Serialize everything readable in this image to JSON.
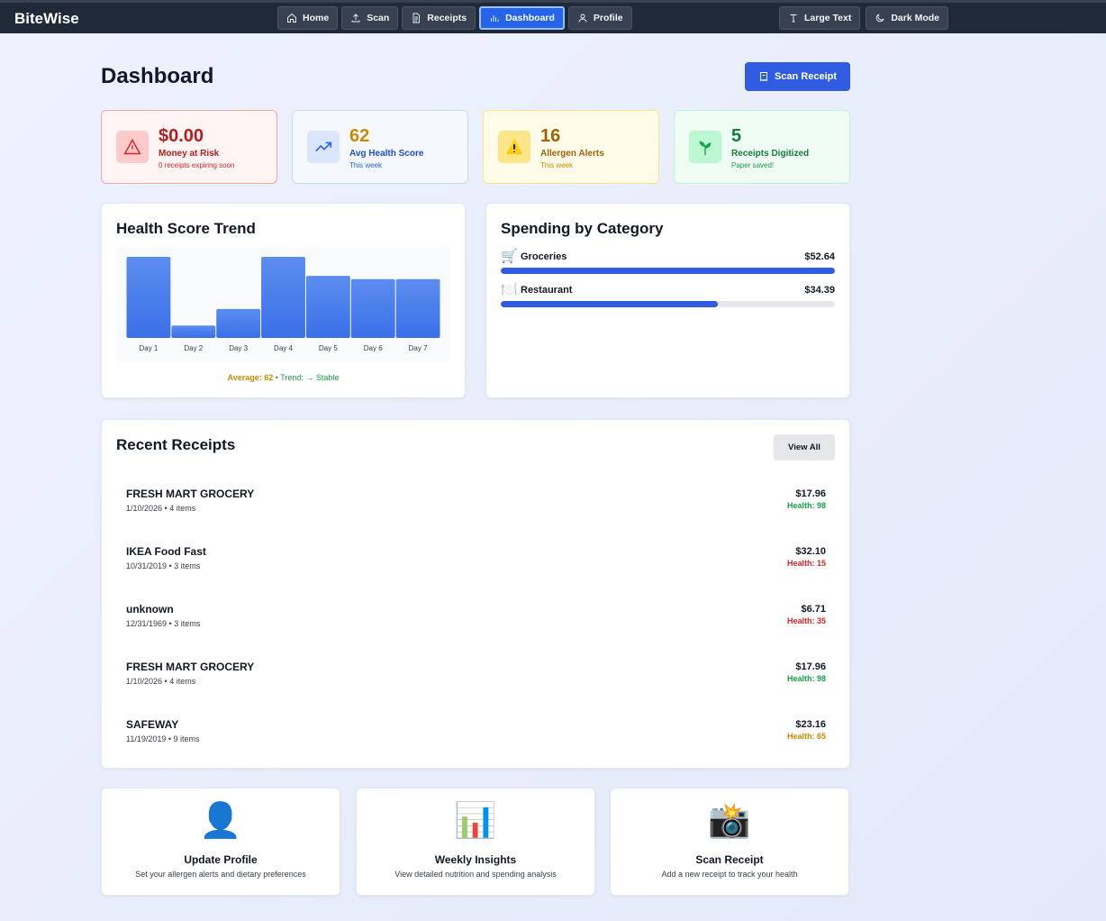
{
  "brand": "BiteWise",
  "nav": {
    "items": [
      {
        "label": "Home",
        "icon": "home-icon"
      },
      {
        "label": "Scan",
        "icon": "upload-icon"
      },
      {
        "label": "Receipts",
        "icon": "document-icon"
      },
      {
        "label": "Dashboard",
        "icon": "bar-chart-icon",
        "active": true
      },
      {
        "label": "Profile",
        "icon": "user-icon"
      }
    ],
    "large_text": "Large Text",
    "dark_mode": "Dark Mode"
  },
  "page_title": "Dashboard",
  "scan_receipt_btn": "Scan Receipt",
  "stats": [
    {
      "value": "$0.00",
      "label": "Money at Risk",
      "sub": "0 receipts expiring soon",
      "icon": "warning-triangle-icon",
      "color": "#b91c1c"
    },
    {
      "value": "62",
      "label": "Avg Health Score",
      "sub": "This week",
      "icon": "trending-up-icon",
      "color": "#ca8a04",
      "label_color": "#1d4ed8"
    },
    {
      "value": "16",
      "label": "Allergen Alerts",
      "sub": "This week",
      "icon": "warning-emoji-icon",
      "color": "#a16207"
    },
    {
      "value": "5",
      "label": "Receipts Digitized",
      "sub": "Paper saved!",
      "icon": "herb-icon",
      "color": "#15803d"
    }
  ],
  "health_trend": {
    "title": "Health Score Trend",
    "footer_avg": "Average: 62",
    "footer_sep": " • ",
    "footer_trend": "Trend: → Stable"
  },
  "chart_data": {
    "type": "bar",
    "title": "Health Score Trend",
    "categories": [
      "Day 1",
      "Day 2",
      "Day 3",
      "Day 4",
      "Day 5",
      "Day 6",
      "Day 7"
    ],
    "values": [
      98,
      15,
      35,
      98,
      75,
      71,
      71
    ],
    "ylim": [
      0,
      98
    ],
    "colors": [
      "#5b8def",
      "#3b6fe8"
    ]
  },
  "spending": {
    "title": "Spending by Category",
    "categories": [
      {
        "emoji": "🛒",
        "name": "Groceries",
        "amount": "$52.64",
        "fraction": 1.0
      },
      {
        "emoji": "🍽️",
        "name": "Restaurant",
        "amount": "$34.39",
        "fraction": 0.65
      }
    ]
  },
  "receipts": {
    "title": "Recent Receipts",
    "view_all": "View All",
    "items": [
      {
        "store": "FRESH MART GROCERY",
        "meta": "1/10/2026 • 4 items",
        "price": "$17.96",
        "health": "Health: 98",
        "health_color": "#16a34a"
      },
      {
        "store": "IKEA Food Fast",
        "meta": "10/31/2019 • 3 items",
        "price": "$32.10",
        "health": "Health: 15",
        "health_color": "#dc2626"
      },
      {
        "store": "unknown",
        "meta": "12/31/1969 • 3 items",
        "price": "$6.71",
        "health": "Health: 35",
        "health_color": "#dc2626"
      },
      {
        "store": "FRESH MART GROCERY",
        "meta": "1/10/2026 • 4 items",
        "price": "$17.96",
        "health": "Health: 98",
        "health_color": "#16a34a"
      },
      {
        "store": "SAFEWAY",
        "meta": "11/19/2019 • 9 items",
        "price": "$23.16",
        "health": "Health: 65",
        "health_color": "#ca8a04"
      }
    ]
  },
  "quick_actions": [
    {
      "emoji": "👤",
      "title": "Update Profile",
      "desc": "Set your allergen alerts and dietary preferences"
    },
    {
      "emoji": "📊",
      "title": "Weekly Insights",
      "desc": "View detailed nutrition and spending analysis"
    },
    {
      "emoji": "📸",
      "title": "Scan Receipt",
      "desc": "Add a new receipt to track your health"
    }
  ]
}
